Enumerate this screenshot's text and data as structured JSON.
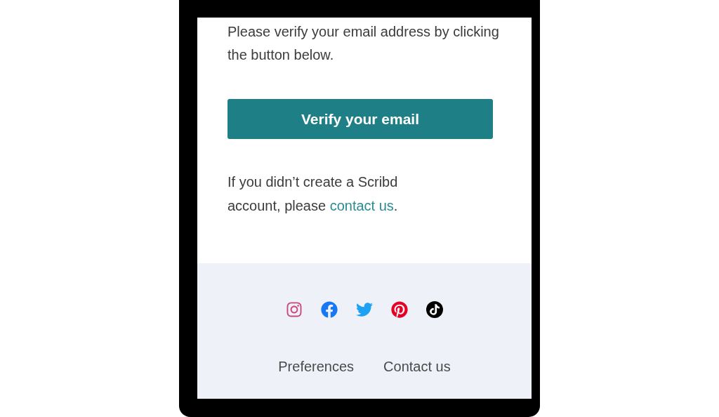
{
  "email": {
    "intro": "Please verify your email address by clicking the button below.",
    "button": "Verify your email",
    "note": "If you didn’t create a Scribd account, please ",
    "note_link": "contact us",
    "note_end": "."
  },
  "footer": {
    "social_links": [
      {
        "kind": "instagram"
      },
      {
        "kind": "facebook"
      },
      {
        "kind": "twitter"
      },
      {
        "kind": "pinterest"
      },
      {
        "kind": "tiktok"
      }
    ],
    "links": [
      "Preferences",
      "Contact us"
    ]
  }
}
